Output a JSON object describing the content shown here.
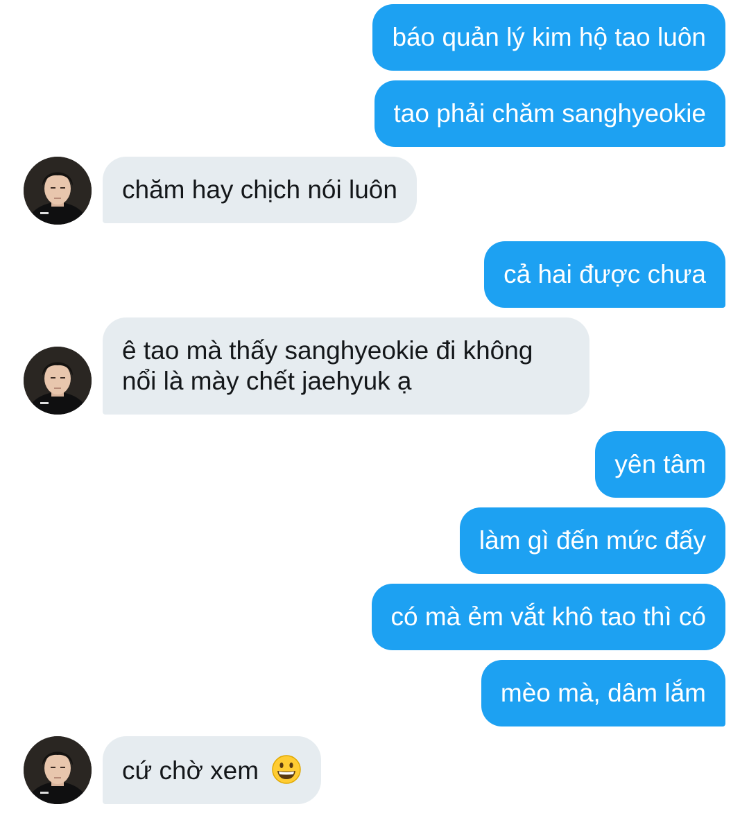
{
  "conversation": {
    "messages": [
      {
        "direction": "sent",
        "text": "báo quản lý kim hộ tao luôn"
      },
      {
        "direction": "sent",
        "text": "tao phải chăm sanghyeokie"
      },
      {
        "direction": "received",
        "text": "chăm hay chịch nói luôn"
      },
      {
        "direction": "sent",
        "text": "cả hai được chưa"
      },
      {
        "direction": "received",
        "text": "ê tao mà thấy sanghyeokie đi không nổi là mày chết jaehyuk ạ"
      },
      {
        "direction": "sent",
        "text": "yên tâm"
      },
      {
        "direction": "sent",
        "text": "làm gì đến mức đấy"
      },
      {
        "direction": "sent",
        "text": "có mà ẻm vắt khô tao thì có"
      },
      {
        "direction": "sent",
        "text": "mèo mà, dâm lắm"
      },
      {
        "direction": "received",
        "text": "cứ chờ xem",
        "emoji": "grinning-face-emoji"
      }
    ]
  },
  "colors": {
    "sent_bubble": "#1da1f2",
    "received_bubble": "#e6ecf0",
    "sent_text": "#ffffff",
    "received_text": "#14171a"
  },
  "icons": {
    "avatar": "contact-avatar-photo",
    "emoji": "grinning-face-emoji"
  }
}
